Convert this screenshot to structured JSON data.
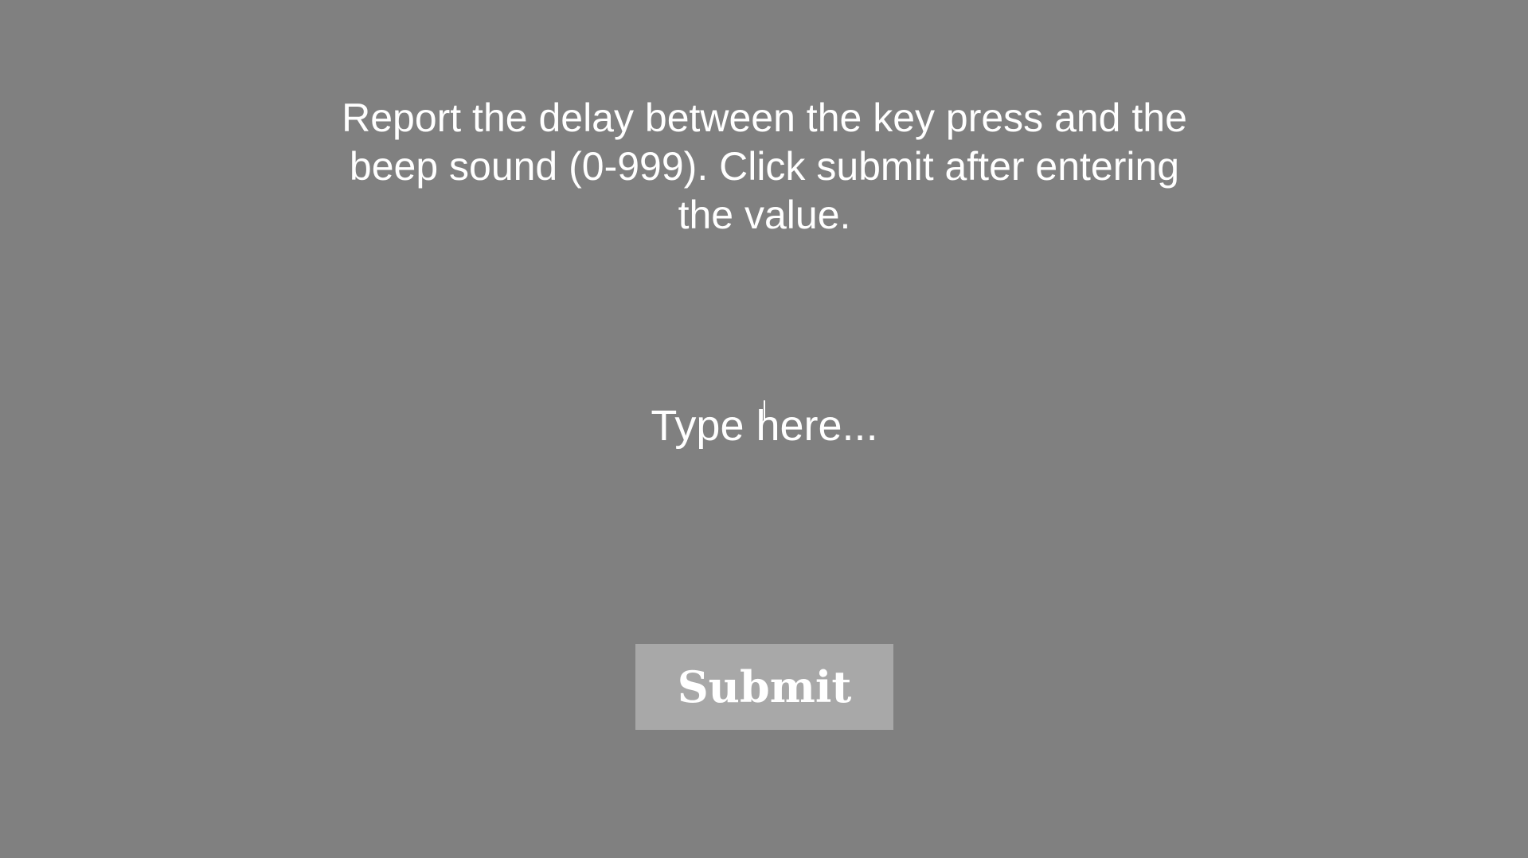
{
  "instruction": {
    "text": "Report the delay between the key press and the beep sound (0-999). Click submit after entering the value."
  },
  "input": {
    "placeholder": "Type here...",
    "value": ""
  },
  "submit": {
    "label": "Submit"
  },
  "colors": {
    "background": "#808080",
    "text": "#ffffff",
    "button_bg": "#a8a8a8"
  }
}
